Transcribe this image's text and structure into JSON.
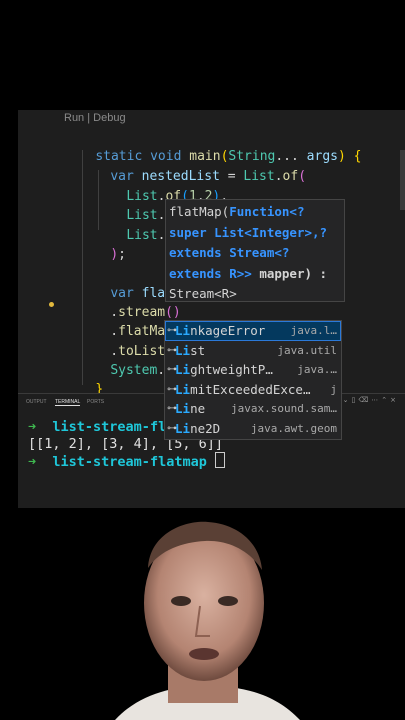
{
  "editor": {
    "codelens": "Run | Debug",
    "lines": [
      "static void main(String... args) {",
      "var nestedList = List.of(",
      "List.of(1,2),",
      "List.of(3,4),",
      "List.of(5",
      ");",
      "var flatLis",
      ".stream()",
      ".flatMap(Li)",
      ".toList();",
      "System.out.",
      "}",
      "}"
    ]
  },
  "signature_help": {
    "name": "flatMap(",
    "param_type": "Function<?",
    "line2": "super List<Integer>,?",
    "line3": "extends Stream<?",
    "line4a": "extends R>>",
    "line4b": " mapper) :",
    "line5": "Stream<R>"
  },
  "suggestions": [
    {
      "match": "Li",
      "rest": "nkageError",
      "detail": "java.l…",
      "selected": true
    },
    {
      "match": "Li",
      "rest": "st",
      "detail": "java.util",
      "selected": false
    },
    {
      "match": "Li",
      "rest": "ghtweightP…",
      "detail": "java.…",
      "selected": false
    },
    {
      "match": "Li",
      "rest": "mitExceededExce…",
      "detail": "j",
      "selected": false
    },
    {
      "match": "Li",
      "rest": "ne",
      "detail": "javax.sound.sam…",
      "selected": false
    },
    {
      "match": "Li",
      "rest": "ne2D",
      "detail": "java.awt.geom",
      "selected": false
    }
  ],
  "panel": {
    "tabs": [
      "OUTPUT",
      "TERMINAL",
      "PORTS"
    ],
    "active_tab": "TERMINAL",
    "terminal": {
      "prompt_arrow": "➜",
      "cwd": "list-stream-flatmap",
      "cwd_cut": "list-stream-flat",
      "output": "[[1, 2], [3, 4], [5, 6]]"
    }
  }
}
